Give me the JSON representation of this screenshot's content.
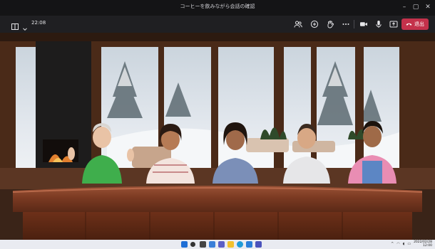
{
  "window": {
    "title": "コーヒーを飲みながら会話の確認"
  },
  "toolbar": {
    "call_timer": "22:08",
    "leave_label": "退出"
  },
  "taskbar": {
    "clock_time": "2022/02/28",
    "clock_date": "12:00"
  },
  "colors": {
    "leave_red": "#c4314b",
    "toolbar_bg": "#1f1f22",
    "titlebar_bg": "#141416"
  },
  "icons": [
    "layout-icon",
    "chevron-down-icon",
    "participants-icon",
    "chat-icon",
    "raise-hand-icon",
    "more-icon",
    "camera-icon",
    "microphone-icon",
    "share-icon",
    "phone-hangup-icon",
    "start-icon",
    "search-icon",
    "taskview-icon",
    "widgets-icon",
    "chat-app-icon",
    "explorer-icon",
    "edge-icon",
    "store-icon",
    "teams-icon"
  ]
}
